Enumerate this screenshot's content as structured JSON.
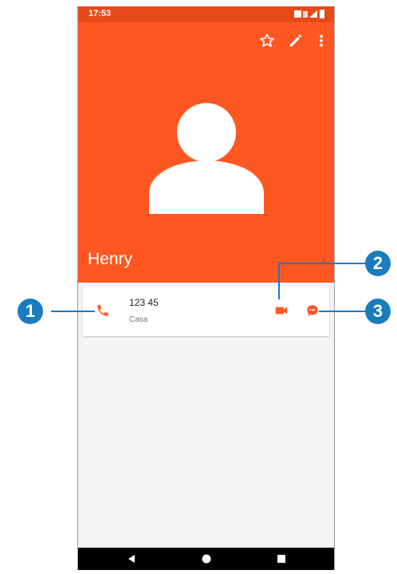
{
  "status_bar": {
    "time": "17:53"
  },
  "toolbar": {
    "icons": [
      "star-outline-icon",
      "pencil-icon",
      "more-vert-icon"
    ]
  },
  "contact": {
    "name": "Henry",
    "avatar_icon": "person-icon"
  },
  "phone_entry": {
    "number": "123 45",
    "type": "Casa",
    "call_icon": "phone-icon",
    "video_icon": "video-call-icon",
    "message_icon": "message-icon"
  },
  "nav": {
    "icons": [
      "back-icon",
      "home-icon",
      "recents-icon"
    ]
  },
  "callouts": {
    "one": "1",
    "two": "2",
    "three": "3"
  },
  "colors": {
    "header": "#ff5722",
    "status_bar": "#e64a19",
    "accent": "#ff5722",
    "callout": "#1a7bbf",
    "nav_bar": "#000000",
    "background": "#f4f4f4"
  }
}
